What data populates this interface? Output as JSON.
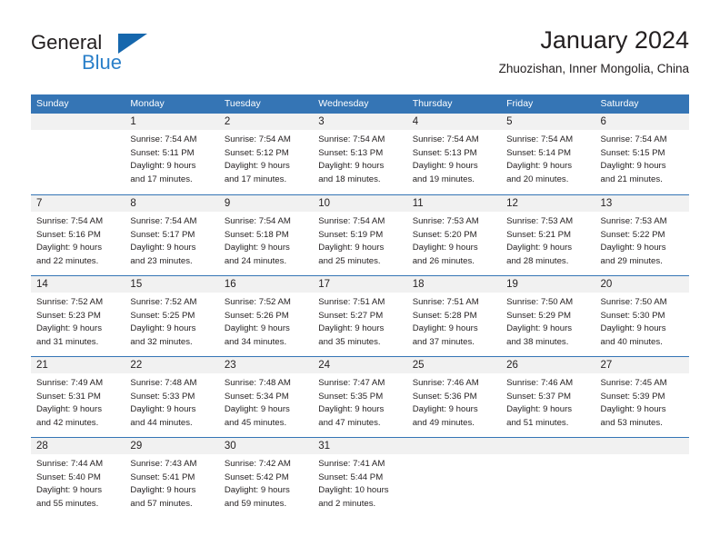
{
  "brand": {
    "name_part1": "General",
    "name_part2": "Blue",
    "triangle_color": "#1667ad",
    "blue_color": "#2a7fc9"
  },
  "header": {
    "title": "January 2024",
    "subtitle": "Zhuozishan, Inner Mongolia, China"
  },
  "colors": {
    "header_blue": "#3575b5",
    "daynum_band": "#f1f1f1",
    "text": "#231f20"
  },
  "calendar": {
    "weekday_headers": [
      "Sunday",
      "Monday",
      "Tuesday",
      "Wednesday",
      "Thursday",
      "Friday",
      "Saturday"
    ],
    "weeks": [
      [
        {
          "day": "",
          "lines": []
        },
        {
          "day": "1",
          "lines": [
            "Sunrise: 7:54 AM",
            "Sunset: 5:11 PM",
            "Daylight: 9 hours",
            "and 17 minutes."
          ]
        },
        {
          "day": "2",
          "lines": [
            "Sunrise: 7:54 AM",
            "Sunset: 5:12 PM",
            "Daylight: 9 hours",
            "and 17 minutes."
          ]
        },
        {
          "day": "3",
          "lines": [
            "Sunrise: 7:54 AM",
            "Sunset: 5:13 PM",
            "Daylight: 9 hours",
            "and 18 minutes."
          ]
        },
        {
          "day": "4",
          "lines": [
            "Sunrise: 7:54 AM",
            "Sunset: 5:13 PM",
            "Daylight: 9 hours",
            "and 19 minutes."
          ]
        },
        {
          "day": "5",
          "lines": [
            "Sunrise: 7:54 AM",
            "Sunset: 5:14 PM",
            "Daylight: 9 hours",
            "and 20 minutes."
          ]
        },
        {
          "day": "6",
          "lines": [
            "Sunrise: 7:54 AM",
            "Sunset: 5:15 PM",
            "Daylight: 9 hours",
            "and 21 minutes."
          ]
        }
      ],
      [
        {
          "day": "7",
          "lines": [
            "Sunrise: 7:54 AM",
            "Sunset: 5:16 PM",
            "Daylight: 9 hours",
            "and 22 minutes."
          ]
        },
        {
          "day": "8",
          "lines": [
            "Sunrise: 7:54 AM",
            "Sunset: 5:17 PM",
            "Daylight: 9 hours",
            "and 23 minutes."
          ]
        },
        {
          "day": "9",
          "lines": [
            "Sunrise: 7:54 AM",
            "Sunset: 5:18 PM",
            "Daylight: 9 hours",
            "and 24 minutes."
          ]
        },
        {
          "day": "10",
          "lines": [
            "Sunrise: 7:54 AM",
            "Sunset: 5:19 PM",
            "Daylight: 9 hours",
            "and 25 minutes."
          ]
        },
        {
          "day": "11",
          "lines": [
            "Sunrise: 7:53 AM",
            "Sunset: 5:20 PM",
            "Daylight: 9 hours",
            "and 26 minutes."
          ]
        },
        {
          "day": "12",
          "lines": [
            "Sunrise: 7:53 AM",
            "Sunset: 5:21 PM",
            "Daylight: 9 hours",
            "and 28 minutes."
          ]
        },
        {
          "day": "13",
          "lines": [
            "Sunrise: 7:53 AM",
            "Sunset: 5:22 PM",
            "Daylight: 9 hours",
            "and 29 minutes."
          ]
        }
      ],
      [
        {
          "day": "14",
          "lines": [
            "Sunrise: 7:52 AM",
            "Sunset: 5:23 PM",
            "Daylight: 9 hours",
            "and 31 minutes."
          ]
        },
        {
          "day": "15",
          "lines": [
            "Sunrise: 7:52 AM",
            "Sunset: 5:25 PM",
            "Daylight: 9 hours",
            "and 32 minutes."
          ]
        },
        {
          "day": "16",
          "lines": [
            "Sunrise: 7:52 AM",
            "Sunset: 5:26 PM",
            "Daylight: 9 hours",
            "and 34 minutes."
          ]
        },
        {
          "day": "17",
          "lines": [
            "Sunrise: 7:51 AM",
            "Sunset: 5:27 PM",
            "Daylight: 9 hours",
            "and 35 minutes."
          ]
        },
        {
          "day": "18",
          "lines": [
            "Sunrise: 7:51 AM",
            "Sunset: 5:28 PM",
            "Daylight: 9 hours",
            "and 37 minutes."
          ]
        },
        {
          "day": "19",
          "lines": [
            "Sunrise: 7:50 AM",
            "Sunset: 5:29 PM",
            "Daylight: 9 hours",
            "and 38 minutes."
          ]
        },
        {
          "day": "20",
          "lines": [
            "Sunrise: 7:50 AM",
            "Sunset: 5:30 PM",
            "Daylight: 9 hours",
            "and 40 minutes."
          ]
        }
      ],
      [
        {
          "day": "21",
          "lines": [
            "Sunrise: 7:49 AM",
            "Sunset: 5:31 PM",
            "Daylight: 9 hours",
            "and 42 minutes."
          ]
        },
        {
          "day": "22",
          "lines": [
            "Sunrise: 7:48 AM",
            "Sunset: 5:33 PM",
            "Daylight: 9 hours",
            "and 44 minutes."
          ]
        },
        {
          "day": "23",
          "lines": [
            "Sunrise: 7:48 AM",
            "Sunset: 5:34 PM",
            "Daylight: 9 hours",
            "and 45 minutes."
          ]
        },
        {
          "day": "24",
          "lines": [
            "Sunrise: 7:47 AM",
            "Sunset: 5:35 PM",
            "Daylight: 9 hours",
            "and 47 minutes."
          ]
        },
        {
          "day": "25",
          "lines": [
            "Sunrise: 7:46 AM",
            "Sunset: 5:36 PM",
            "Daylight: 9 hours",
            "and 49 minutes."
          ]
        },
        {
          "day": "26",
          "lines": [
            "Sunrise: 7:46 AM",
            "Sunset: 5:37 PM",
            "Daylight: 9 hours",
            "and 51 minutes."
          ]
        },
        {
          "day": "27",
          "lines": [
            "Sunrise: 7:45 AM",
            "Sunset: 5:39 PM",
            "Daylight: 9 hours",
            "and 53 minutes."
          ]
        }
      ],
      [
        {
          "day": "28",
          "lines": [
            "Sunrise: 7:44 AM",
            "Sunset: 5:40 PM",
            "Daylight: 9 hours",
            "and 55 minutes."
          ]
        },
        {
          "day": "29",
          "lines": [
            "Sunrise: 7:43 AM",
            "Sunset: 5:41 PM",
            "Daylight: 9 hours",
            "and 57 minutes."
          ]
        },
        {
          "day": "30",
          "lines": [
            "Sunrise: 7:42 AM",
            "Sunset: 5:42 PM",
            "Daylight: 9 hours",
            "and 59 minutes."
          ]
        },
        {
          "day": "31",
          "lines": [
            "Sunrise: 7:41 AM",
            "Sunset: 5:44 PM",
            "Daylight: 10 hours",
            "and 2 minutes."
          ]
        },
        {
          "day": "",
          "lines": []
        },
        {
          "day": "",
          "lines": []
        },
        {
          "day": "",
          "lines": []
        }
      ]
    ]
  }
}
